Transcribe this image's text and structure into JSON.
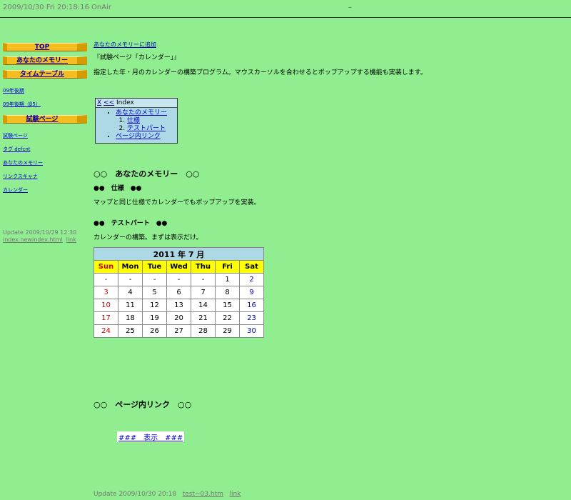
{
  "header": {
    "clock": "2009/10/30 Fri 20:18:16   OnAir",
    "dash": "–"
  },
  "sidebar": {
    "btn_top": "TOP",
    "btn_memory": "あなたのメモリー",
    "btn_timetable": "タイムテーブル",
    "link_1": "09年後期",
    "link_2": "09年後期（β5）",
    "btn_test": "試験ページ",
    "links": [
      "試験ページ",
      "タグ defcnt",
      "あなたのメモリー",
      "リンクスキャナ",
      "カレンダー"
    ],
    "update": "Update 2009/10/29 12:30",
    "update_link1": "index newindex.html",
    "update_link2": "link"
  },
  "main": {
    "top_link": "あなたのメモリーに追加",
    "title": "『試験ページ「カレンダー」』",
    "desc": "指定した年・月のカレンダーの構築プログラム。マウスカーソルを合わせるとポップアップする機能も実装します。",
    "index": {
      "close": "X",
      "back": "<<",
      "label": "Index",
      "item1": "あなたのメモリー",
      "sub1": "仕様",
      "sub2": "テストパート",
      "item2": "ページ内リンク"
    },
    "sec1_title": "○○　あなたのメモリー　○○",
    "sec1_sub1": "●●　仕様　●●",
    "sec1_text1": "マップと同じ仕様でカレンダーでもポップアップを実装。",
    "sec1_sub2": "●●　テストパート　●●",
    "sec1_text2": "カレンダーの構築。まずは表示だけ。",
    "sec2_title": "○○　ページ内リンク　○○",
    "display_link": "###　表示　###",
    "footer": "Update 2009/10/30 20:18",
    "footer_link1": "test~03.htm",
    "footer_link2": "link"
  },
  "calendar": {
    "caption": "2011 年 7 月",
    "days": [
      "Sun",
      "Mon",
      "Tue",
      "Wed",
      "Thu",
      "Fri",
      "Sat"
    ],
    "rows": [
      [
        "-",
        "-",
        "-",
        "-",
        "-",
        "1",
        "2"
      ],
      [
        "3",
        "4",
        "5",
        "6",
        "7",
        "8",
        "9"
      ],
      [
        "10",
        "11",
        "12",
        "13",
        "14",
        "15",
        "16"
      ],
      [
        "17",
        "18",
        "19",
        "20",
        "21",
        "22",
        "23"
      ],
      [
        "24",
        "25",
        "26",
        "27",
        "28",
        "29",
        "30"
      ]
    ],
    "colors": {
      "sunday": "#cc0000",
      "saturday": "#0000aa",
      "header": "#ffff00",
      "caption": "#add8e6"
    }
  }
}
